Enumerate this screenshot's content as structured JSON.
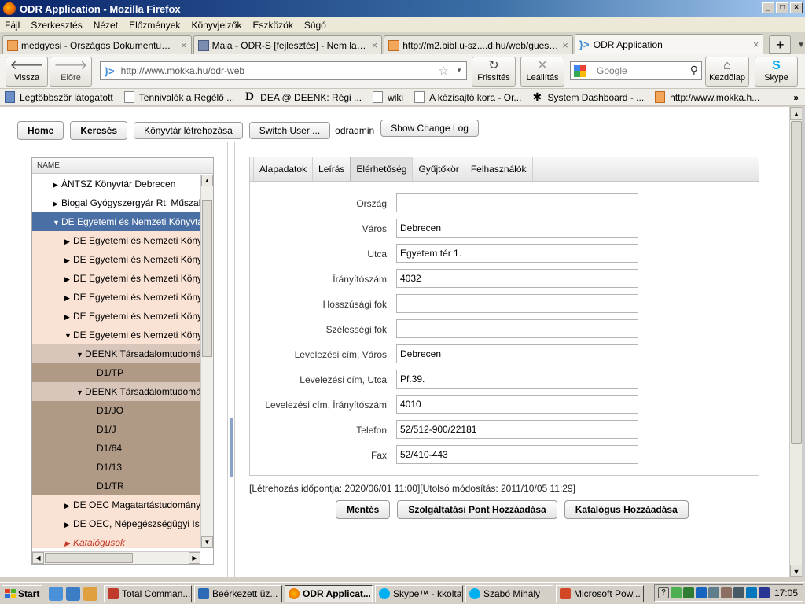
{
  "window": {
    "title": "ODR Application - Mozilla Firefox"
  },
  "menu": [
    "Fájl",
    "Szerkesztés",
    "Nézet",
    "Előzmények",
    "Könyvjelzők",
    "Eszközök",
    "Súgó"
  ],
  "tabs": [
    {
      "title": "medgyesi - Országos Dokumentumellát...",
      "close": "×"
    },
    {
      "title": "Maia - ODR-S [fejlesztés] - Nem latszik ...",
      "close": "×"
    },
    {
      "title": "http://m2.bibl.u-sz....d.hu/web/guest/odr",
      "close": "×"
    },
    {
      "title": "ODR Application",
      "close": "×"
    }
  ],
  "nav": {
    "back": "Vissza",
    "forward": "Előre",
    "url": "http://www.mokka.hu/odr-web",
    "reload": "Frissítés",
    "stop": "Leállítás",
    "search_placeholder": "Google",
    "home": "Kezdőlap",
    "skype": "Skype"
  },
  "bookmarks": [
    "Legtöbbször látogatott",
    "Tennivalók a Regélő ...",
    "DEA @ DEENK: Régi ...",
    "wiki",
    "A kézisajtó kora - Or...",
    "System Dashboard - ...",
    "http://www.mokka.h..."
  ],
  "toolbar": {
    "home": "Home",
    "search": "Keresés",
    "create_library": "Könyvtár létrehozása",
    "switch_user": "Switch User ...",
    "username": "odradmin",
    "change_log": "Show Change Log"
  },
  "tree": {
    "header": "NAME",
    "nodes": [
      {
        "label": "ÁNTSZ Könyvtár Debrecen",
        "toggle": "▶"
      },
      {
        "label": "Biogal Gyógyszergyár Rt. Műszaki",
        "toggle": "▶"
      },
      {
        "label": "DE Egyetemi és Nemzeti Könyvtár",
        "toggle": "▼"
      },
      {
        "label": "DE Egyetemi és Nemzeti Könyvtár",
        "toggle": "▶"
      },
      {
        "label": "DE Egyetemi és Nemzeti Könyvtár",
        "toggle": "▶"
      },
      {
        "label": "DE Egyetemi és Nemzeti Könyvtár",
        "toggle": "▶"
      },
      {
        "label": "DE Egyetemi és Nemzeti Könyvtár",
        "toggle": "▶"
      },
      {
        "label": "DE Egyetemi és Nemzeti Könyvtár",
        "toggle": "▶"
      },
      {
        "label": "DE Egyetemi és Nemzeti Könyvtár",
        "toggle": "▼"
      },
      {
        "label": "DEENK Társadalomtudományi",
        "toggle": "▼"
      },
      {
        "label": "D1/TP",
        "toggle": ""
      },
      {
        "label": "DEENK Társadalomtudományi",
        "toggle": "▼"
      },
      {
        "label": "D1/JO",
        "toggle": ""
      },
      {
        "label": "D1/J",
        "toggle": ""
      },
      {
        "label": "D1/64",
        "toggle": ""
      },
      {
        "label": "D1/13",
        "toggle": ""
      },
      {
        "label": "D1/TR",
        "toggle": ""
      },
      {
        "label": "DE OEC Magatartástudományi",
        "toggle": "▶"
      },
      {
        "label": "DE OEC, Népegészségügyi Iskola",
        "toggle": "▶"
      },
      {
        "label": "Katalógusok",
        "toggle": "▶"
      }
    ]
  },
  "panel_tabs": [
    "Alapadatok",
    "Leírás",
    "Elérhetőség",
    "Gyűjtőkör",
    "Felhasználók"
  ],
  "form": [
    {
      "label": "Ország",
      "value": ""
    },
    {
      "label": "Város",
      "value": "Debrecen"
    },
    {
      "label": "Utca",
      "value": "Egyetem tér 1."
    },
    {
      "label": "Írányítószám",
      "value": "4032"
    },
    {
      "label": "Hosszúsági fok",
      "value": ""
    },
    {
      "label": "Szélességi fok",
      "value": ""
    },
    {
      "label": "Levelezési cím, Város",
      "value": "Debrecen"
    },
    {
      "label": "Levelezési cím, Utca",
      "value": "Pf.39."
    },
    {
      "label": "Levelezési cím, Írányítószám",
      "value": "4010"
    },
    {
      "label": "Telefon",
      "value": "52/512-900/22181"
    },
    {
      "label": "Fax",
      "value": "52/410-443"
    }
  ],
  "meta": "[Létrehozás időpontja: 2020/06/01 11:00][Utolsó módosítás: 2011/10/05 11:29]",
  "actions": {
    "save": "Mentés",
    "add_service_point": "Szolgáltatási Pont Hozzáadása",
    "add_catalog": "Katalógus Hozzáadása"
  },
  "taskbar": {
    "start": "Start",
    "tasks": [
      "Total Comman...",
      "Beérkezett üz...",
      "ODR Applicat...",
      "Skype™ - kkoltay",
      "Szabó Mihály",
      "Microsoft Pow..."
    ],
    "clock": "17:05"
  },
  "colors": {
    "selected_node": "#4a6fa5",
    "node_light": "#fae3d5",
    "node_mid": "#d8c6ba",
    "node_dark": "#b09a86",
    "catalog_text": "#c0392b"
  }
}
